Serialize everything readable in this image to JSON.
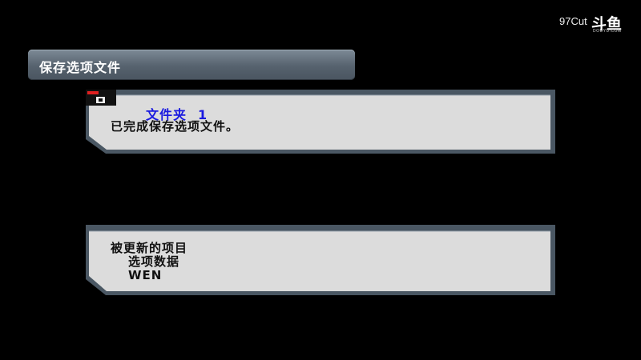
{
  "header": {
    "title": "保存选项文件"
  },
  "status_panel": {
    "folder_label": "文件夹",
    "folder_number": "1",
    "message": "已完成保存选项文件。"
  },
  "updated_panel": {
    "heading": "被更新的项目",
    "item_type": "选项数据",
    "item_name": "WEN"
  },
  "watermark": {
    "prefix": "97Cut",
    "brand": "斗鱼",
    "domain": "DOUYU.COM"
  },
  "colors": {
    "panel_face": "#dcdcdc",
    "panel_border": "#4a5763",
    "folder_text": "#1a1ae0",
    "title_bar": "#5e6b77"
  }
}
